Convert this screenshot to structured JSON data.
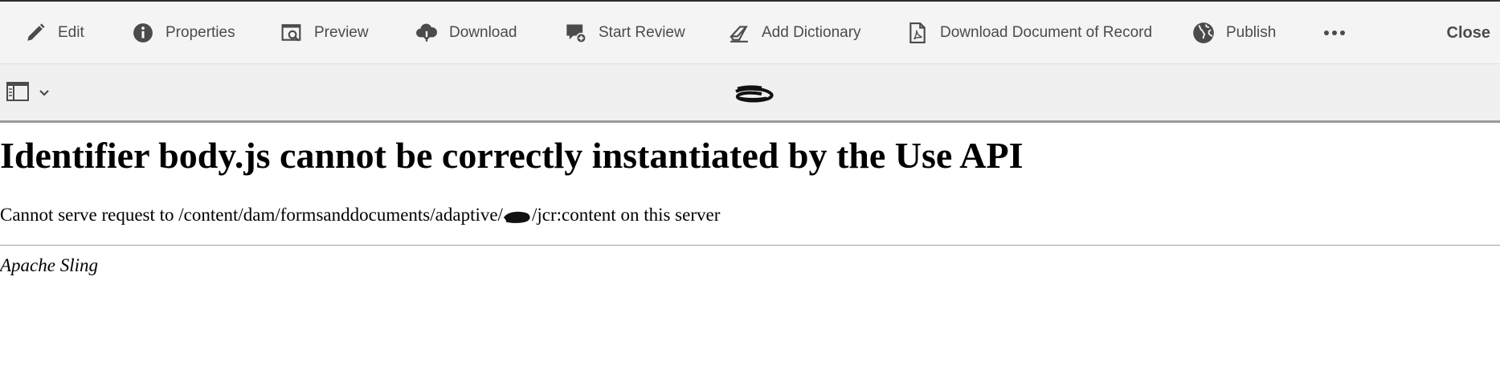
{
  "toolbar": {
    "items": [
      {
        "label": "Edit",
        "icon": "pencil-icon"
      },
      {
        "label": "Properties",
        "icon": "info-icon"
      },
      {
        "label": "Preview",
        "icon": "preview-icon"
      },
      {
        "label": "Download",
        "icon": "cloud-download-icon"
      },
      {
        "label": "Start Review",
        "icon": "comment-add-icon"
      },
      {
        "label": "Add Dictionary",
        "icon": "eraser-icon"
      },
      {
        "label": "Download Document of Record",
        "icon": "pdf-file-icon"
      },
      {
        "label": "Publish",
        "icon": "globe-icon"
      }
    ],
    "more_icon": "more-icon",
    "close_label": "Close"
  },
  "subbar": {
    "panel_icon": "panel-toggle-icon",
    "chevron_icon": "chevron-down-icon"
  },
  "error": {
    "heading": "Identifier body.js cannot be correctly instantiated by the Use API",
    "message_prefix": "Cannot serve request to /content/dam/formsanddocuments/adaptive/",
    "message_suffix": "/jcr:content on this server",
    "footer": "Apache Sling"
  },
  "colors": {
    "toolbar_bg": "#f4f4f4",
    "subbar_bg": "#f0f0f0",
    "toolbar_text": "#4b4b4b",
    "separator": "#9a9a9a"
  }
}
